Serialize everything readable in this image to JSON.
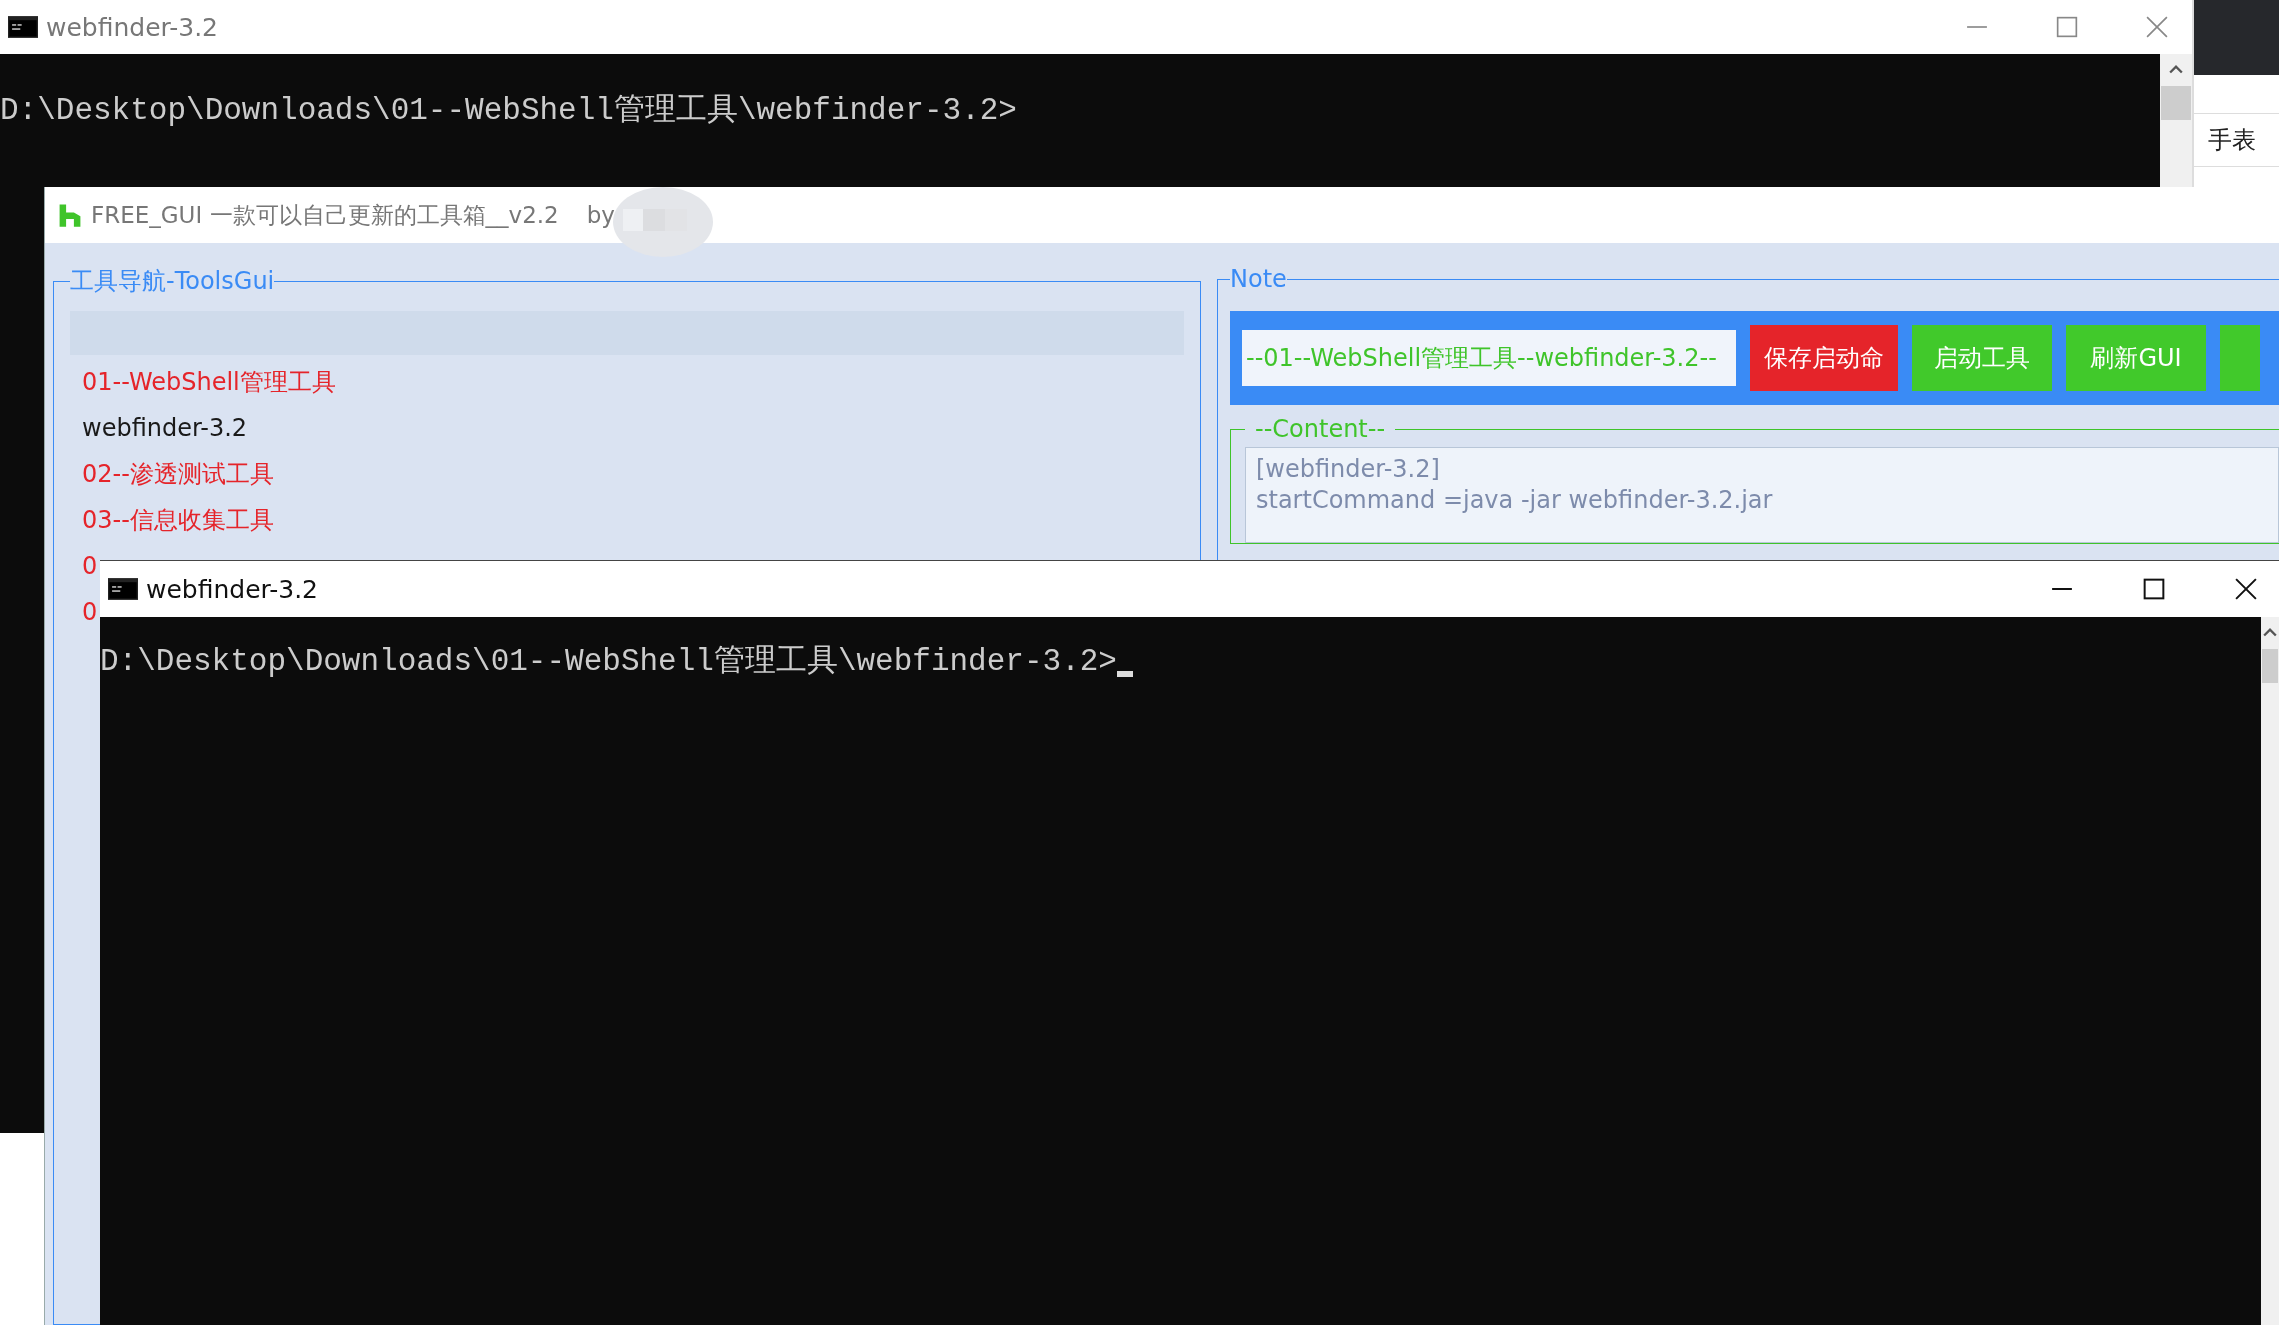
{
  "back_console": {
    "title": "webfinder-3.2",
    "active": false,
    "prompt": "D:\\Desktop\\Downloads\\01--WebShell管理工具\\webfinder-3.2>"
  },
  "side_panel": {
    "label": "手表"
  },
  "free_gui": {
    "title": "FREE_GUI 一款可以自己更新的工具箱__v2.2",
    "by": "by",
    "nav": {
      "legend": "工具导航-ToolsGui",
      "items": [
        {
          "label": "01--WebShell管理工具",
          "kind": "category"
        },
        {
          "label": "webfinder-3.2",
          "kind": "tool"
        },
        {
          "label": "02--渗透测试工具",
          "kind": "category"
        },
        {
          "label": "03--信息收集工具",
          "kind": "category"
        },
        {
          "label": "0",
          "kind": "category"
        },
        {
          "label": "0",
          "kind": "category"
        }
      ]
    },
    "note": {
      "legend": "Note",
      "path_field": {
        "value": "--01--WebShell管理工具--webfinder-3.2--"
      },
      "buttons": [
        {
          "label": "保存启动命",
          "color": "#e5242a"
        },
        {
          "label": "启动工具",
          "color": "#41c92b"
        },
        {
          "label": "刷新GUI",
          "color": "#41c92b"
        },
        {
          "color": "#41c92b"
        }
      ],
      "content": {
        "legend": "--Content--",
        "lines": [
          "[webfinder-3.2]",
          "startCommand =java -jar webfinder-3.2.jar"
        ]
      }
    }
  },
  "front_console": {
    "title": "webfinder-3.2",
    "active": true,
    "prompt": "D:\\Desktop\\Downloads\\01--WebShell管理工具\\webfinder-3.2>"
  }
}
